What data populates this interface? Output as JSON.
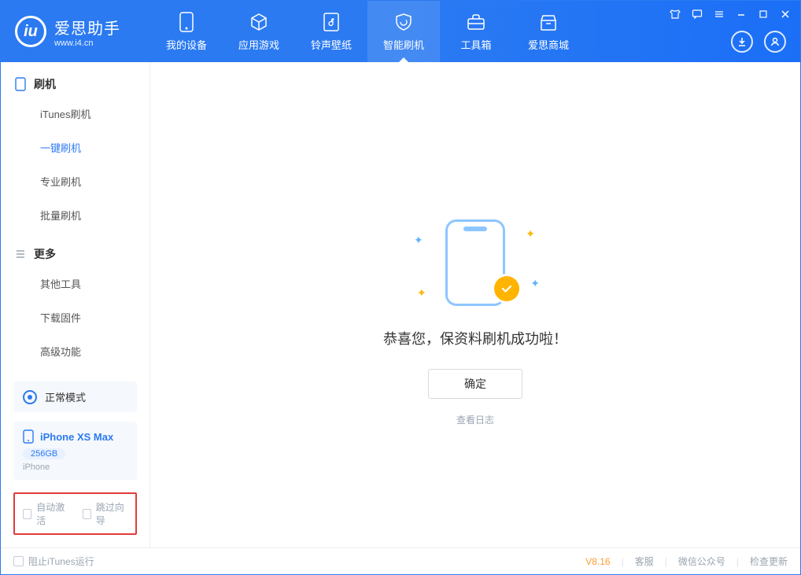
{
  "app": {
    "name_cn": "爱思助手",
    "url": "www.i4.cn"
  },
  "nav": [
    {
      "label": "我的设备"
    },
    {
      "label": "应用游戏"
    },
    {
      "label": "铃声壁纸"
    },
    {
      "label": "智能刷机",
      "active": true
    },
    {
      "label": "工具箱"
    },
    {
      "label": "爱思商城"
    }
  ],
  "sidebar": {
    "group1_title": "刷机",
    "group1_items": [
      {
        "label": "iTunes刷机"
      },
      {
        "label": "一键刷机",
        "active": true
      },
      {
        "label": "专业刷机"
      },
      {
        "label": "批量刷机"
      }
    ],
    "group2_title": "更多",
    "group2_items": [
      {
        "label": "其他工具"
      },
      {
        "label": "下载固件"
      },
      {
        "label": "高级功能"
      }
    ]
  },
  "mode": {
    "label": "正常模式"
  },
  "device": {
    "name": "iPhone XS Max",
    "capacity": "256GB",
    "type": "iPhone"
  },
  "options": {
    "auto_activate": "自动激活",
    "skip_guide": "跳过向导"
  },
  "main": {
    "success_text": "恭喜您，保资料刷机成功啦！",
    "ok_button": "确定",
    "view_log": "查看日志"
  },
  "status": {
    "block_itunes": "阻止iTunes运行",
    "version": "V8.16",
    "service": "客服",
    "wechat": "微信公众号",
    "update": "检查更新"
  }
}
